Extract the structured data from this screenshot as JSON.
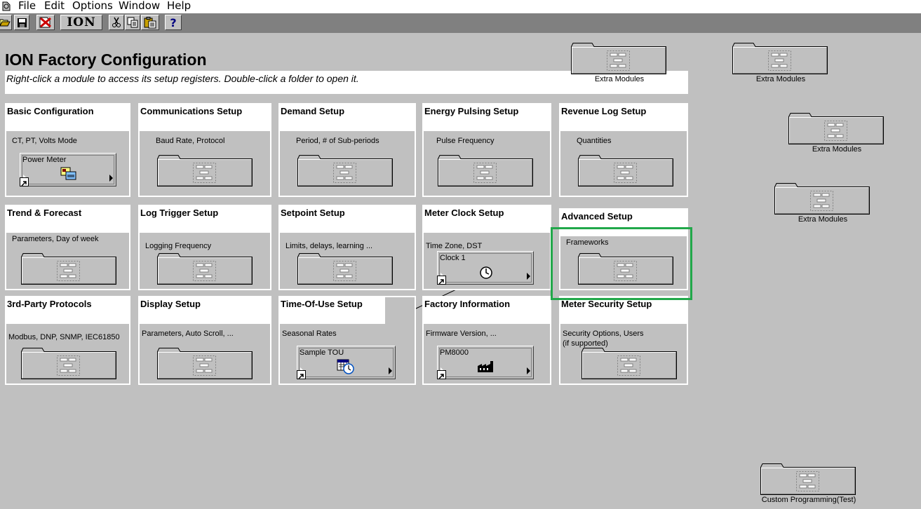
{
  "menu": [
    "File",
    "Edit",
    "Options",
    "Window",
    "Help"
  ],
  "toolbar": {
    "ion_logo": "ION",
    "help": "?",
    "icons": [
      "open-folder-icon",
      "save-icon",
      "disconnect-icon",
      "ion-logo",
      "cut-icon",
      "copy-icon",
      "paste-icon",
      "help-icon"
    ]
  },
  "page": {
    "title": "ION Factory Configuration",
    "instructions": "Right-click a module to access its setup registers.  Double-click a folder to open it."
  },
  "panels": [
    {
      "title": "Basic Configuration",
      "desc": "CT, PT, Volts Mode",
      "shortcut": "Power Meter"
    },
    {
      "title": "Communications Setup",
      "desc": "Baud Rate, Protocol"
    },
    {
      "title": "Demand Setup",
      "desc": "Period, # of Sub-periods"
    },
    {
      "title": "Energy Pulsing Setup",
      "desc": "Pulse Frequency"
    },
    {
      "title": "Revenue Log Setup",
      "desc": "Quantities"
    },
    {
      "title": "Trend & Forecast",
      "desc": "Parameters, Day of week"
    },
    {
      "title": "Log Trigger Setup",
      "desc": "Logging Frequency"
    },
    {
      "title": "Setpoint Setup",
      "desc": "Limits, delays, learning ..."
    },
    {
      "title": "Meter Clock Setup",
      "desc": "Time Zone, DST",
      "shortcut": "Clock 1"
    },
    {
      "title": "Advanced Setup",
      "desc": "Frameworks"
    },
    {
      "title": "3rd-Party Protocols",
      "desc": "Modbus, DNP, SNMP, IEC61850"
    },
    {
      "title": "Display Setup",
      "desc": "Parameters, Auto Scroll, ..."
    },
    {
      "title": "Time-Of-Use Setup",
      "desc": "Seasonal Rates",
      "shortcut": "Sample TOU"
    },
    {
      "title": "Factory Information",
      "desc": "Firmware Version, ...",
      "shortcut": "PM8000"
    },
    {
      "title": "Meter Security Setup",
      "desc": "Security Options, Users",
      "desc2": "(if supported)"
    }
  ],
  "extra_folders": [
    "Extra Modules",
    "Extra Modules",
    "Extra Modules",
    "Extra Modules",
    "Custom Programming(Test)"
  ],
  "colors": {
    "background": "#c0c0c0",
    "highlight": "#21a84a",
    "toolbar": "#808080"
  }
}
